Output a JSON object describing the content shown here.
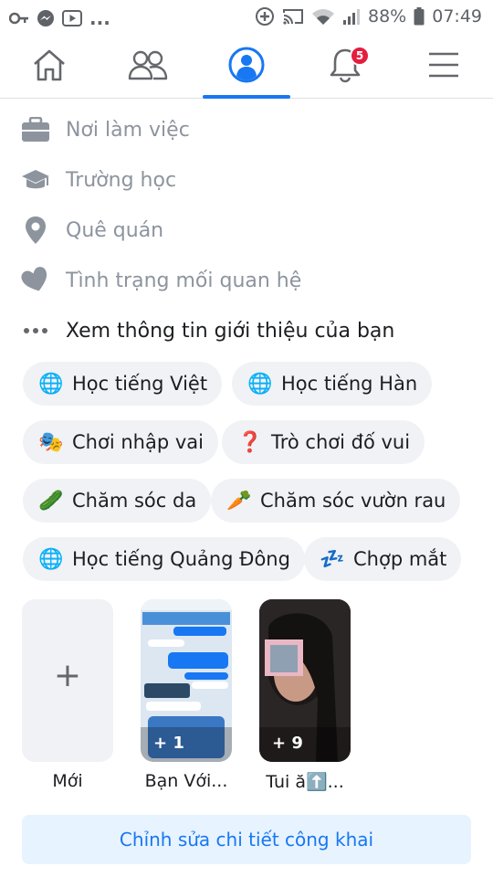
{
  "status_bar": {
    "left_icons": [
      "key-icon",
      "messenger-icon",
      "youtube-icon"
    ],
    "more": "...",
    "right_icons": [
      "data-saver-icon",
      "cast-icon",
      "wifi-icon",
      "signal-icon"
    ],
    "battery": "88%",
    "time": "07:49"
  },
  "nav": {
    "tabs": [
      {
        "name": "home",
        "icon": "home-icon"
      },
      {
        "name": "friends",
        "icon": "friends-icon"
      },
      {
        "name": "profile",
        "icon": "profile-icon",
        "active": true
      },
      {
        "name": "notifications",
        "icon": "bell-icon",
        "badge": "5"
      },
      {
        "name": "menu",
        "icon": "menu-icon"
      }
    ],
    "accent": "#1877f2"
  },
  "about": {
    "workplace": "Nơi làm việc",
    "school": "Trường học",
    "hometown": "Quê quán",
    "relationship": "Tình trạng mối quan hệ",
    "see_about": "Xem thông tin giới thiệu của bạn"
  },
  "hobbies": [
    {
      "emoji": "🌐",
      "label": "Học tiếng Việt"
    },
    {
      "emoji": "🌐",
      "label": "Học tiếng Hàn"
    },
    {
      "emoji": "🎭",
      "label": "Chơi nhập vai"
    },
    {
      "emoji": "❓",
      "label": "Trò chơi đố vui"
    },
    {
      "emoji": "🥒",
      "label": "Chăm sóc da"
    },
    {
      "emoji": "🥕",
      "label": "Chăm sóc vườn rau"
    },
    {
      "emoji": "🌐",
      "label": "Học tiếng Quảng Đông"
    },
    {
      "emoji": "💤",
      "label": "Chợp mắt"
    }
  ],
  "featured": {
    "new_label": "Mới",
    "new_symbol": "+",
    "stories": [
      {
        "label": "Bạn Với...",
        "count": "+ 1"
      },
      {
        "label": "Tui ă⬆️...",
        "count": "+ 9"
      }
    ]
  },
  "edit_button": "Chỉnh sửa chi tiết công khai"
}
